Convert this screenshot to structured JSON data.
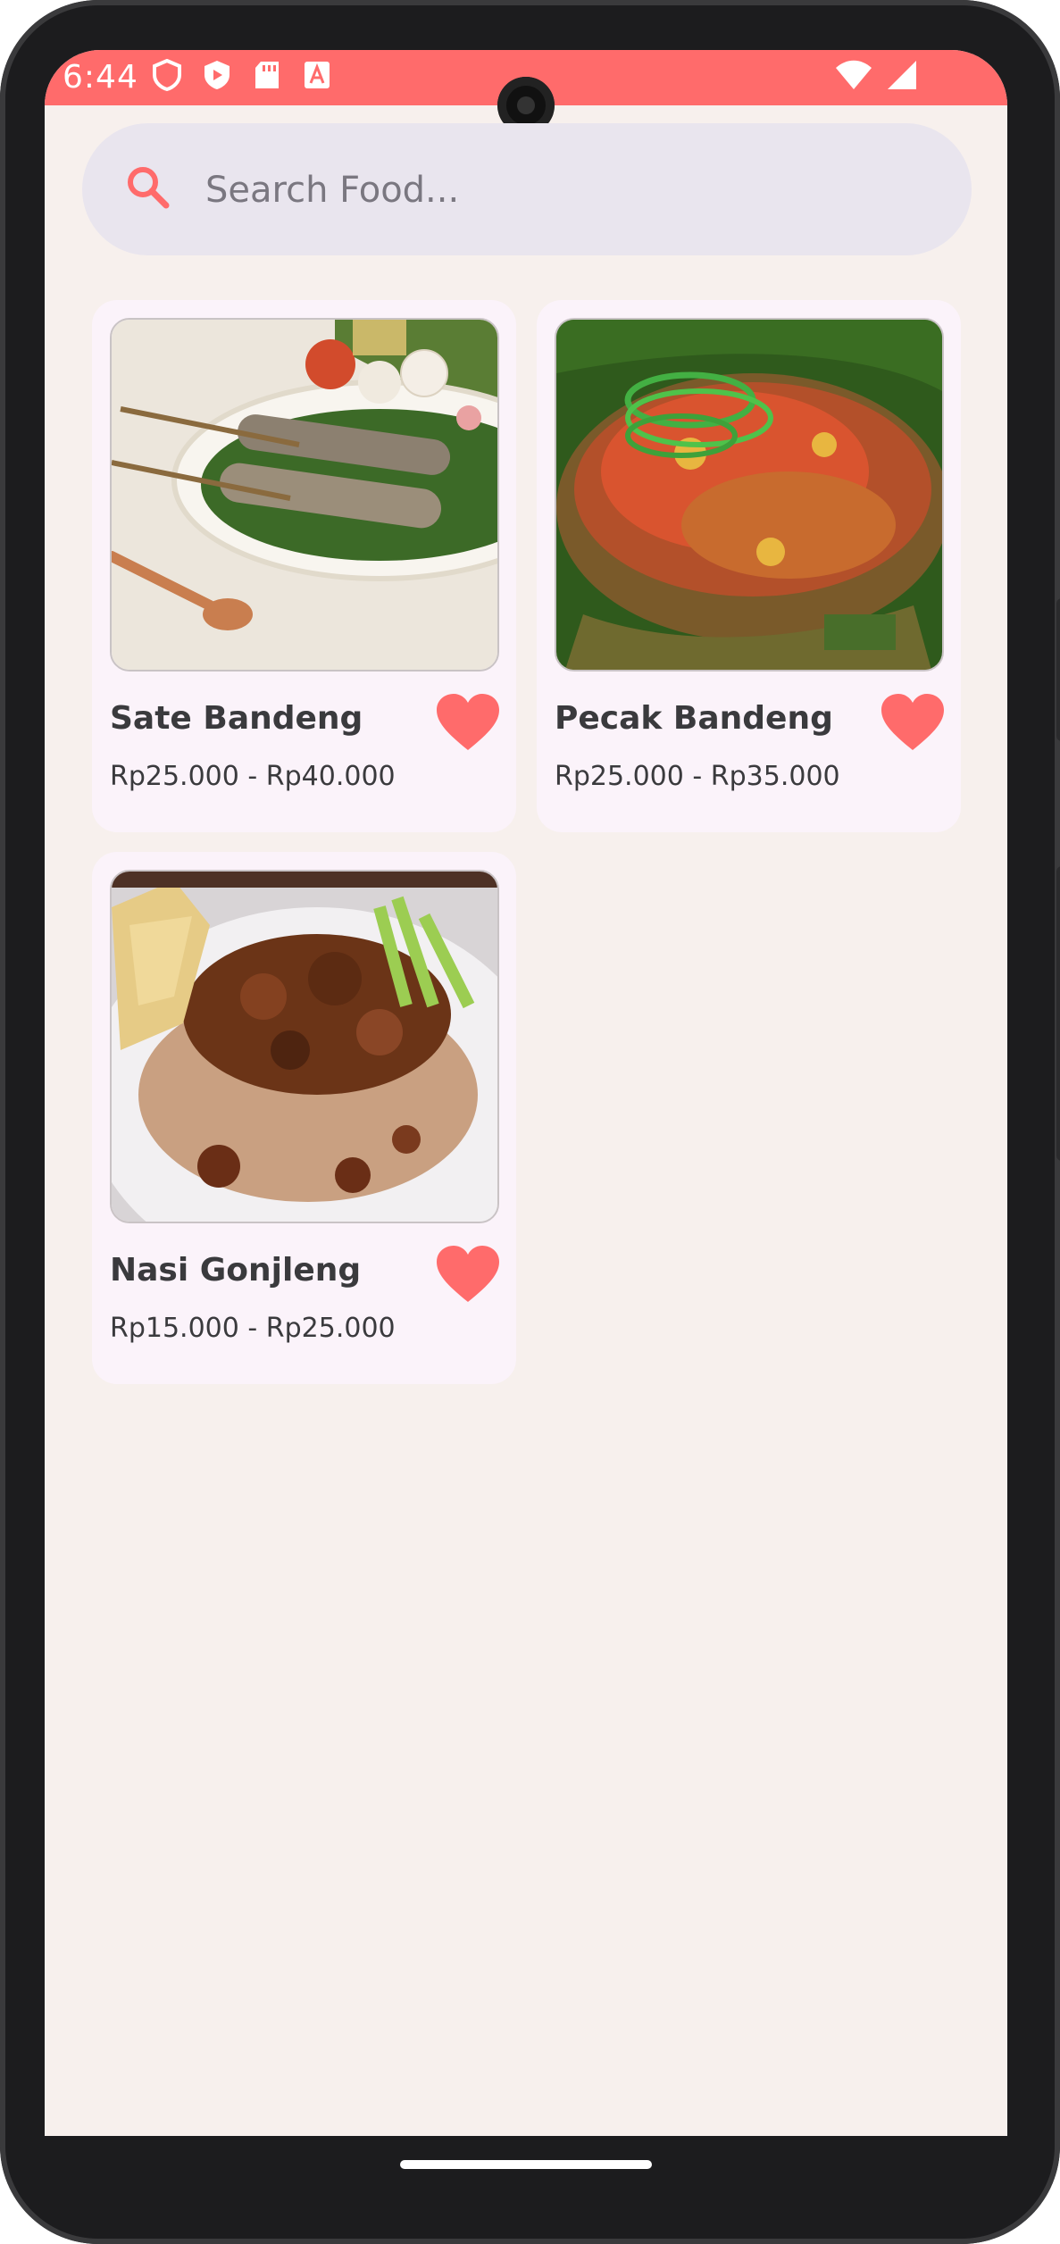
{
  "status_bar": {
    "time": "6:44",
    "background": "#ff6b6b",
    "icons": [
      "shield-icon",
      "play-protect-icon",
      "sd-card-icon",
      "font-a-icon"
    ],
    "right_icons": [
      "wifi-icon",
      "signal-icon"
    ]
  },
  "search": {
    "placeholder": "Search Food...",
    "icon": "search-icon",
    "accent": "#ff6b6b"
  },
  "foods": [
    {
      "name": "Sate Bandeng",
      "price": "Rp25.000 - Rp40.000",
      "favorite": true
    },
    {
      "name": "Pecak Bandeng",
      "price": "Rp25.000 - Rp35.000",
      "favorite": true
    },
    {
      "name": "Nasi Gonjleng",
      "price": "Rp15.000 - Rp25.000",
      "favorite": true
    }
  ],
  "colors": {
    "accent": "#ff6b6b",
    "background": "#f7f0ed",
    "card": "#fbf3fa",
    "search_bg": "#e9e5ee"
  }
}
